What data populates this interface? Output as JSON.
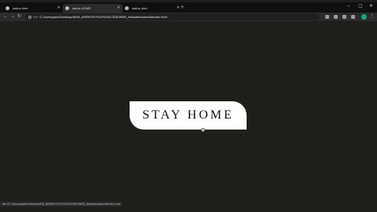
{
  "tabs": [
    {
      "title": "status.html",
      "active": false
    },
    {
      "title": "status.HOME",
      "active": true
    },
    {
      "title": "status.html",
      "active": false
    }
  ],
  "new_tab_label": "+",
  "window_controls": {
    "minimize": "–",
    "maximize": "▢",
    "close": "✕"
  },
  "toolbar": {
    "back": "←",
    "forward": "→",
    "reload": "↻",
    "scheme": "File",
    "url": "C:/Users/yash/Desktop/WEB_WEBSITE/%20%20CODE/WEB_Website/status/ld/index.html",
    "menu": "⋮"
  },
  "page": {
    "headline": "STAY HOME"
  },
  "status_bar": "file:///C:/Users/yash/Desktop/WEB_WEBSITE/%20%20CODE/WEB_Website/status/ld/index.html",
  "colors": {
    "page_background": "#1e1f1b",
    "card_background": "#ffffff",
    "profile_accent": "#1aa37a"
  }
}
